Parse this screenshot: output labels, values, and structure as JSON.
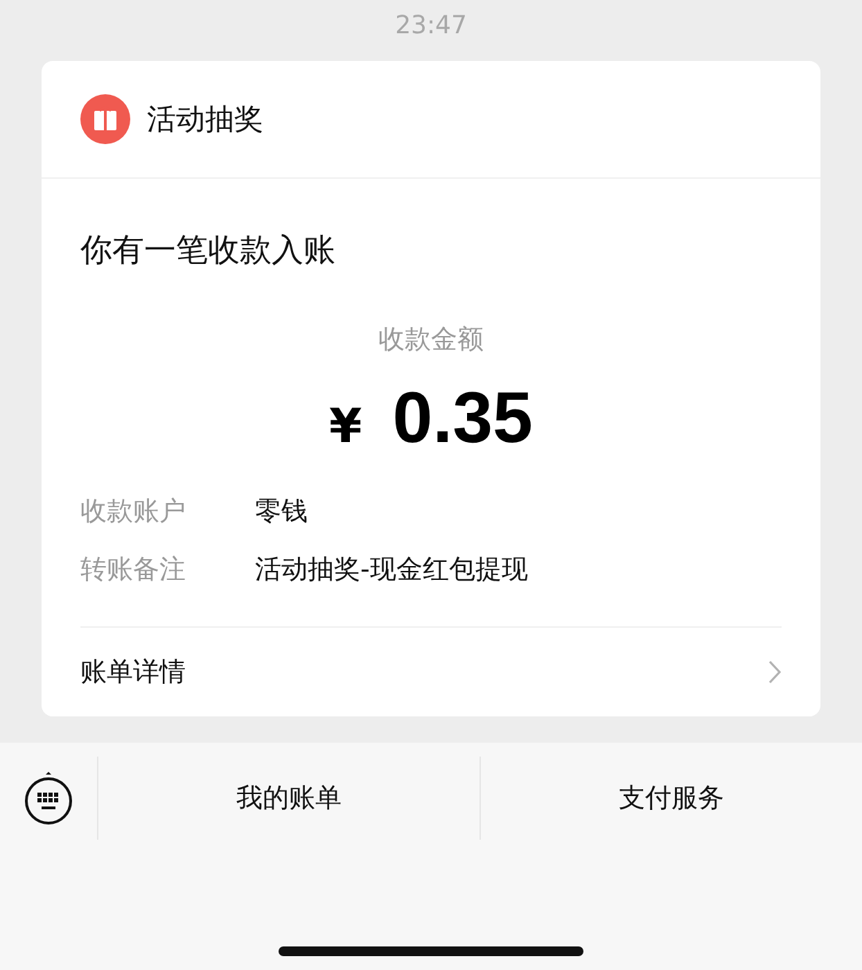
{
  "time": "23:47",
  "card": {
    "source": "活动抽奖",
    "heading": "你有一笔收款入账",
    "amount_label": "收款金额",
    "currency": "¥",
    "amount": "0.35",
    "fields": [
      {
        "label": "收款账户",
        "value": "零钱"
      },
      {
        "label": "转账备注",
        "value": "活动抽奖-现金红包提现"
      }
    ],
    "link": "账单详情"
  },
  "menu": [
    "我的账单",
    "支付服务"
  ]
}
